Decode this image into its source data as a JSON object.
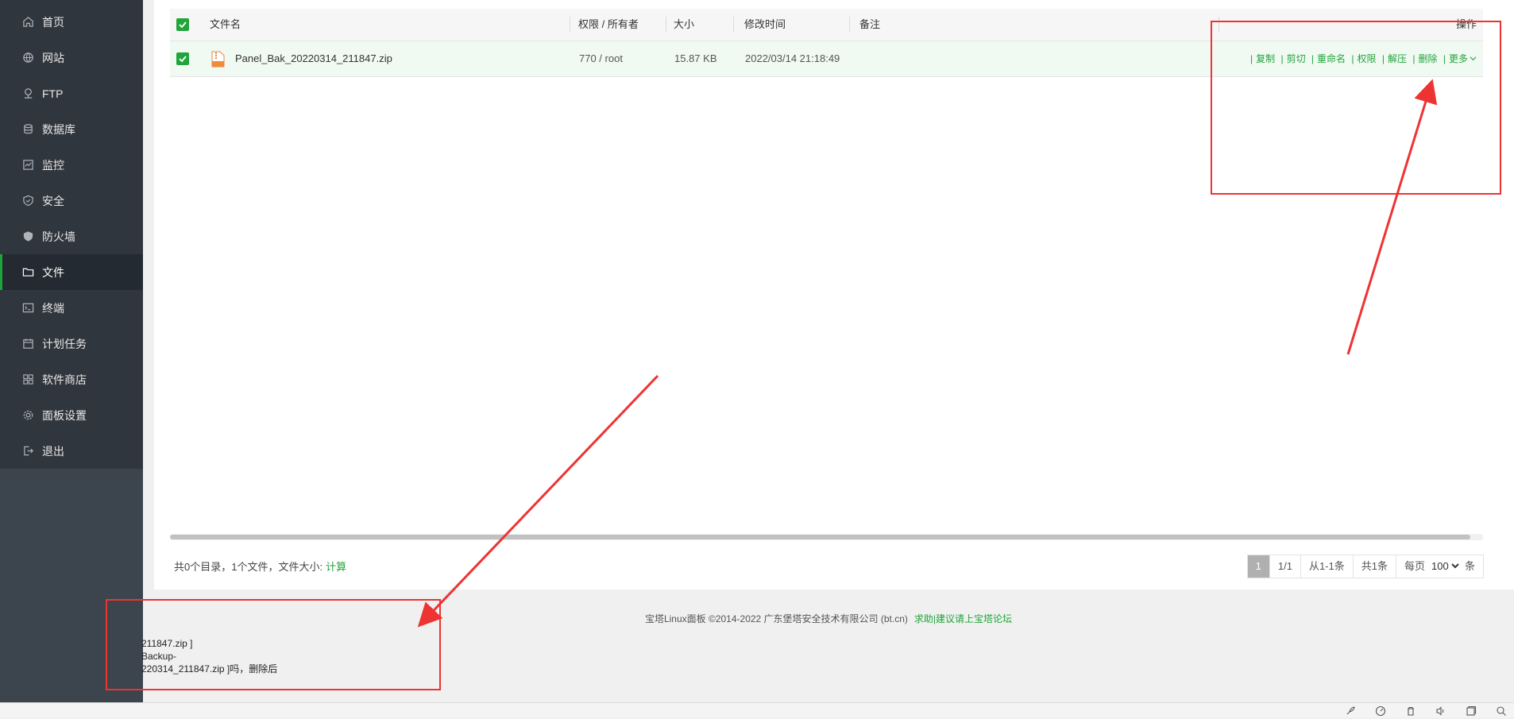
{
  "sidebar": {
    "items": [
      {
        "label": "首页",
        "icon": "home-icon"
      },
      {
        "label": "网站",
        "icon": "globe-icon"
      },
      {
        "label": "FTP",
        "icon": "ftp-icon"
      },
      {
        "label": "数据库",
        "icon": "database-icon"
      },
      {
        "label": "监控",
        "icon": "monitor-icon"
      },
      {
        "label": "安全",
        "icon": "shield-icon"
      },
      {
        "label": "防火墙",
        "icon": "firewall-icon"
      },
      {
        "label": "文件",
        "icon": "folder-icon",
        "active": true
      },
      {
        "label": "终端",
        "icon": "terminal-icon"
      },
      {
        "label": "计划任务",
        "icon": "calendar-icon"
      },
      {
        "label": "软件商店",
        "icon": "apps-icon"
      },
      {
        "label": "面板设置",
        "icon": "gear-icon"
      },
      {
        "label": "退出",
        "icon": "logout-icon"
      }
    ]
  },
  "table": {
    "headers": {
      "name": "文件名",
      "perm": "权限 / 所有者",
      "size": "大小",
      "mtime": "修改时间",
      "note": "备注",
      "ops": "操作"
    },
    "rows": [
      {
        "name": "Panel_Bak_20220314_211847.zip",
        "perm": "770 / root",
        "size": "15.87 KB",
        "mtime": "2022/03/14 21:18:49",
        "note": "",
        "selected": true
      }
    ],
    "ops": [
      "复制",
      "剪切",
      "重命名",
      "权限",
      "解压",
      "删除",
      "更多"
    ]
  },
  "summary": {
    "text": "共0个目录，1个文件，文件大小:",
    "calc_link": "计算"
  },
  "pager": {
    "current": "1",
    "pages": "1/1",
    "range": "从1-1条",
    "total": "共1条",
    "per_page_label": "每页",
    "per_page_value": "100",
    "per_page_options": [
      "100"
    ],
    "unit": "条"
  },
  "footer": {
    "copyright": "宝塔Linux面板 ©2014-2022 广东堡塔安全技术有限公司 (bt.cn)",
    "help_link": "求助|建议请上宝塔论坛"
  },
  "log": {
    "line1": "211847.zip ]",
    "line2": "Backup-",
    "line3": "220314_211847.zip ]吗，删除后"
  },
  "colors": {
    "accent": "#20a53a",
    "annotation": "#ee3333",
    "sidebar_bg": "#30363d"
  }
}
